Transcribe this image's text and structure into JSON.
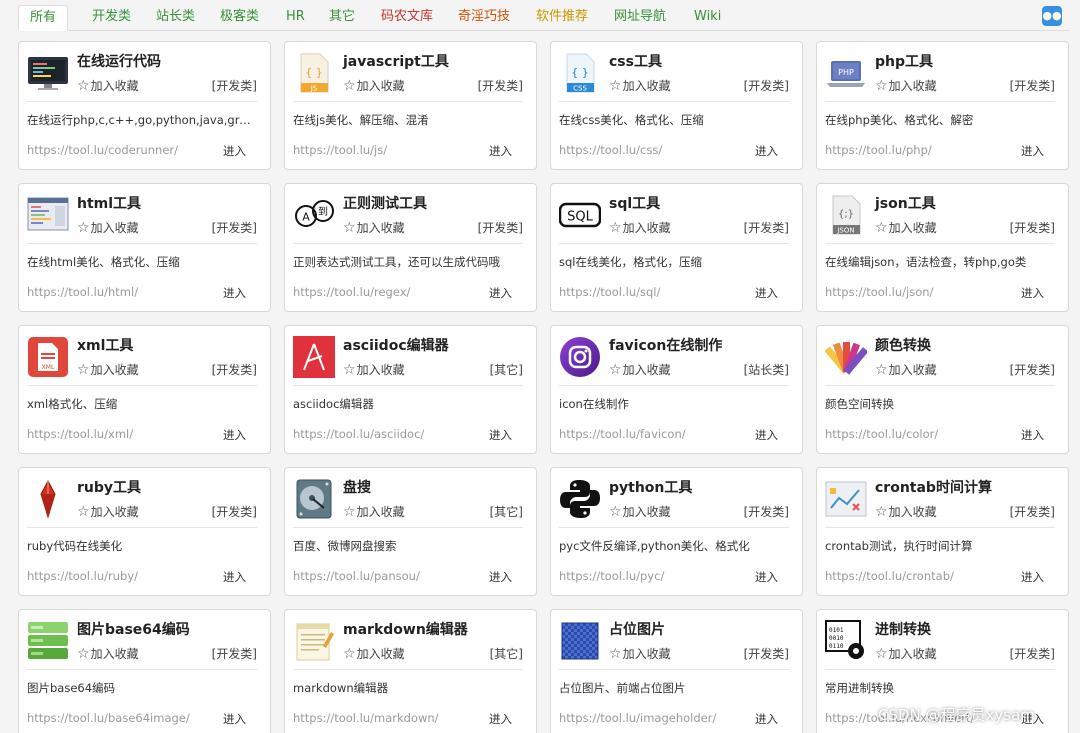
{
  "tabs": [
    {
      "label": "所有",
      "color": "#3a8f3a",
      "active": true
    },
    {
      "label": "开发类",
      "color": "#3a8f3a"
    },
    {
      "label": "站长类",
      "color": "#3a8f3a"
    },
    {
      "label": "极客类",
      "color": "#3a8f3a"
    },
    {
      "label": "HR",
      "color": "#3a8f3a"
    },
    {
      "label": "其它",
      "color": "#3a8f3a"
    },
    {
      "label": "码农文库",
      "color": "#c0392b"
    },
    {
      "label": "奇淫巧技",
      "color": "#d35400"
    },
    {
      "label": "软件推荐",
      "color": "#c79a00"
    },
    {
      "label": "网址导航",
      "color": "#3a8f3a"
    },
    {
      "label": "Wiki",
      "color": "#3a8f3a"
    }
  ],
  "fav_label": "加入收藏",
  "enter_label": "进入",
  "tools": [
    {
      "title": "在线运行代码",
      "category": "[开发类]",
      "desc": "在线运行php,c,c++,go,python,java,gro...",
      "url": "https://tool.lu/coderunner/",
      "icon": "monitor-code-icon"
    },
    {
      "title": "javascript工具",
      "category": "[开发类]",
      "desc": "在线js美化、解压缩、混淆",
      "url": "https://tool.lu/js/",
      "icon": "js-file-icon"
    },
    {
      "title": "css工具",
      "category": "[开发类]",
      "desc": "在线css美化、格式化、压缩",
      "url": "https://tool.lu/css/",
      "icon": "css-file-icon"
    },
    {
      "title": "php工具",
      "category": "[开发类]",
      "desc": "在线php美化、格式化、解密",
      "url": "https://tool.lu/php/",
      "icon": "php-laptop-icon"
    },
    {
      "title": "html工具",
      "category": "[开发类]",
      "desc": "在线html美化、格式化、压缩",
      "url": "https://tool.lu/html/",
      "icon": "html-window-icon"
    },
    {
      "title": "正则测试工具",
      "category": "[开发类]",
      "desc": "正则表达式测试工具，还可以生成代码哦",
      "url": "https://tool.lu/regex/",
      "icon": "regex-bubbles-icon"
    },
    {
      "title": "sql工具",
      "category": "[开发类]",
      "desc": "sql在线美化，格式化，压缩",
      "url": "https://tool.lu/sql/",
      "icon": "sql-badge-icon"
    },
    {
      "title": "json工具",
      "category": "[开发类]",
      "desc": "在线编辑json，语法检查，转php,go类",
      "url": "https://tool.lu/json/",
      "icon": "json-file-icon"
    },
    {
      "title": "xml工具",
      "category": "[开发类]",
      "desc": "xml格式化、压缩",
      "url": "https://tool.lu/xml/",
      "icon": "xml-file-icon"
    },
    {
      "title": "asciidoc编辑器",
      "category": "[其它]",
      "desc": "asciidoc编辑器",
      "url": "https://tool.lu/asciidoc/",
      "icon": "asciidoc-icon"
    },
    {
      "title": "favicon在线制作",
      "category": "[站长类]",
      "desc": "icon在线制作",
      "url": "https://tool.lu/favicon/",
      "icon": "camera-circle-icon"
    },
    {
      "title": "颜色转换",
      "category": "[开发类]",
      "desc": "颜色空间转换",
      "url": "https://tool.lu/color/",
      "icon": "color-swatches-icon"
    },
    {
      "title": "ruby工具",
      "category": "[开发类]",
      "desc": "ruby代码在线美化",
      "url": "https://tool.lu/ruby/",
      "icon": "ruby-gem-icon"
    },
    {
      "title": "盘搜",
      "category": "[其它]",
      "desc": "百度、微博网盘搜索",
      "url": "https://tool.lu/pansou/",
      "icon": "hard-disk-icon"
    },
    {
      "title": "python工具",
      "category": "[开发类]",
      "desc": "pyc文件反编译,python美化、格式化",
      "url": "https://tool.lu/pyc/",
      "icon": "python-logo-icon"
    },
    {
      "title": "crontab时间计算",
      "category": "[开发类]",
      "desc": "crontab测试，执行时间计算",
      "url": "https://tool.lu/crontab/",
      "icon": "chart-board-icon"
    },
    {
      "title": "图片base64编码",
      "category": "[开发类]",
      "desc": "图片base64编码",
      "url": "https://tool.lu/base64image/",
      "icon": "green-stack-icon"
    },
    {
      "title": "markdown编辑器",
      "category": "[其它]",
      "desc": "markdown编辑器",
      "url": "https://tool.lu/markdown/",
      "icon": "notepad-icon"
    },
    {
      "title": "占位图片",
      "category": "[开发类]",
      "desc": "占位图片、前端占位图片",
      "url": "https://tool.lu/imageholder/",
      "icon": "placeholder-pattern-icon"
    },
    {
      "title": "进制转换",
      "category": "[开发类]",
      "desc": "常用进制转换",
      "url": "https://tool.lu/hexconvert/",
      "icon": "binary-gear-icon"
    }
  ],
  "watermark": "CSDN @程序员xysam"
}
